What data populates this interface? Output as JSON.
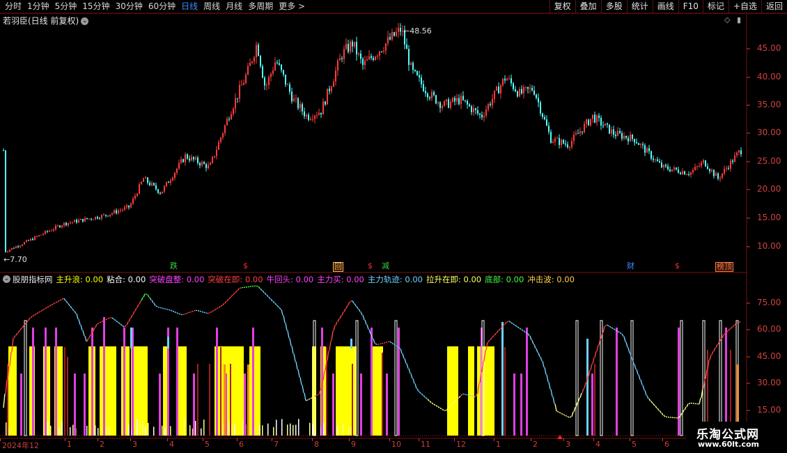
{
  "toolbar": {
    "periods": [
      "分时",
      "1分钟",
      "5分钟",
      "15分钟",
      "30分钟",
      "60分钟",
      "日线",
      "周线",
      "月线",
      "多周期",
      "更多 >"
    ],
    "active_period": "日线",
    "buttons": [
      "复权",
      "叠加",
      "多股",
      "统计",
      "画线",
      "F10",
      "标记",
      "+自选",
      "返回"
    ]
  },
  "stock": {
    "title": "若羽臣(日线 前复权)",
    "high_label": "48.56",
    "low_label": "7.70"
  },
  "price_axis": [
    "45.00",
    "40.00",
    "35.00",
    "30.00",
    "25.00",
    "20.00",
    "15.00",
    "10.00"
  ],
  "chart_labels": [
    {
      "text": "跌",
      "color": "#3ad23a"
    },
    {
      "text": "$",
      "color": "#ff3030"
    },
    {
      "text": "回",
      "color": "#f0c060"
    },
    {
      "text": "$",
      "color": "#ff3030"
    },
    {
      "text": "减",
      "color": "#3ad23a"
    },
    {
      "text": "财",
      "color": "#3f8cff"
    },
    {
      "text": "$",
      "color": "#ff3030"
    },
    {
      "text": "榜顶",
      "color": "#f08050"
    }
  ],
  "indicator": {
    "name": "股朋指标网",
    "items": [
      {
        "label": "主升浪",
        "value": "0.00",
        "color": "#ffff00"
      },
      {
        "label": "粘合",
        "value": "0.00",
        "color": "#ffffff"
      },
      {
        "label": "突破盘整",
        "value": "0.00",
        "color": "#ff40ff"
      },
      {
        "label": "突破在即",
        "value": "0.00",
        "color": "#ff4040"
      },
      {
        "label": "牛回头",
        "value": "0.00",
        "color": "#ff40ff"
      },
      {
        "label": "主力买",
        "value": "0.00",
        "color": "#ff40ff"
      },
      {
        "label": "主力轨迹",
        "value": "0.00",
        "color": "#6fd0ff"
      },
      {
        "label": "拉升在即",
        "value": "0.00",
        "color": "#ffff60"
      },
      {
        "label": "底部",
        "value": "0.00",
        "color": "#40ff40"
      },
      {
        "label": "冲击波",
        "value": "0.00",
        "color": "#ffd040"
      }
    ]
  },
  "indicator_axis": [
    "75.00",
    "60.00",
    "45.00",
    "30.00",
    "15.00"
  ],
  "date_axis": [
    "2024年12",
    "1",
    "2",
    "3",
    "4",
    "5",
    "6",
    "7",
    "8",
    "9",
    "10",
    "11",
    "12",
    "1",
    "2",
    "3",
    "4",
    "5",
    "6"
  ],
  "watermark": {
    "title": "乐淘公式网",
    "url": "www.60lt.com"
  },
  "colors": {
    "up": "#ff3c3c",
    "down": "#54ffff",
    "axis": "#d04040",
    "frame": "#7a1010",
    "active": "#3f8cff"
  }
}
